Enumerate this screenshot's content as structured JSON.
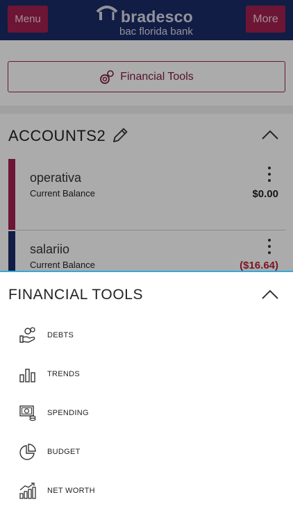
{
  "header": {
    "menu_label": "Menu",
    "more_label": "More",
    "logo_brand": "bradesco",
    "logo_sub": "bac florida bank"
  },
  "financial_tools_button": {
    "label": "Financial Tools"
  },
  "accounts": {
    "title": "ACCOUNTS2",
    "items": [
      {
        "name": "operativa",
        "label": "Current Balance",
        "balance": "$0.00",
        "color": "#a3204e",
        "balance_color": "#222222"
      },
      {
        "name": "salariio",
        "label": "Current Balance",
        "balance": "($16.64)",
        "color": "#1c2c67",
        "balance_color": "#b3223a"
      }
    ]
  },
  "financial_tools_sheet": {
    "title": "FINANCIAL TOOLS",
    "items": [
      {
        "label": "DEBTS",
        "icon": "debts-icon"
      },
      {
        "label": "TRENDS",
        "icon": "trends-icon"
      },
      {
        "label": "SPENDING",
        "icon": "spending-icon"
      },
      {
        "label": "BUDGET",
        "icon": "budget-icon"
      },
      {
        "label": "NET WORTH",
        "icon": "net-worth-icon"
      }
    ]
  },
  "colors": {
    "header_bg": "#1c2c67",
    "brand_accent": "#a3204e",
    "sheet_border": "#33a9dc"
  }
}
